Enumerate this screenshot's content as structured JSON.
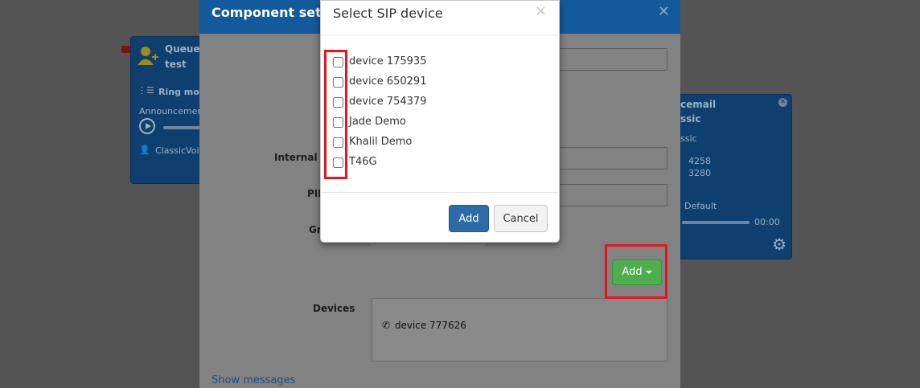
{
  "workflow": {
    "queue_node": {
      "title": "Queue",
      "name": "test",
      "ring_mode_label": "Ring mod",
      "announcement_label": "Announcemen",
      "voice_label": "ClassicVoic"
    },
    "voicemail_node": {
      "title": "cemail",
      "name": "ssic",
      "line1": "ssic",
      "line2": "4258",
      "line3": "3280",
      "default_label": "Default",
      "time": "00:00"
    }
  },
  "component_settings": {
    "title": "Component setti",
    "close_icon": "close-icon",
    "labels": {
      "internal_number": "Internal n",
      "pin": "PIN",
      "group": "Gr",
      "devices": "Devices"
    },
    "add_button_label": "Add",
    "devices": [
      {
        "name": "device 777626",
        "icon": "phone-icon"
      }
    ],
    "show_messages_link": "Show messages"
  },
  "sip_dialog": {
    "title": "Select SIP device",
    "close_glyph": "×",
    "options": [
      {
        "label": "device 175935",
        "checked": false
      },
      {
        "label": "device 650291",
        "checked": false
      },
      {
        "label": "device 754379",
        "checked": false
      },
      {
        "label": "Jade Demo",
        "checked": false
      },
      {
        "label": "Khalil Demo",
        "checked": false
      },
      {
        "label": "T46G",
        "checked": false
      }
    ],
    "add_label": "Add",
    "cancel_label": "Cancel"
  },
  "colors": {
    "annotation_red": "#e8141e",
    "primary_blue": "#2d6aa8",
    "success_green": "#4cae4c",
    "header_blue": "#135a9c"
  }
}
